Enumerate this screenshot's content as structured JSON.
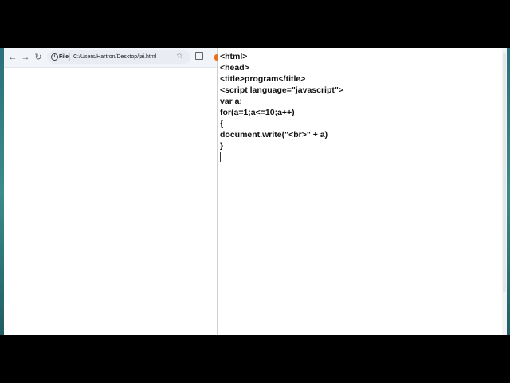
{
  "browser": {
    "back_glyph": "←",
    "forward_glyph": "→",
    "reload_glyph": "↻",
    "info_glyph": "i",
    "file_label": "File",
    "url": "C:/Users/Hartron/Desktop/jai.html",
    "star_glyph": "☆",
    "icons": [
      "back-arrow-icon",
      "forward-arrow-icon",
      "reload-icon",
      "info-icon",
      "star-icon",
      "extensions-icon"
    ]
  },
  "editor": {
    "lines": [
      "<html>",
      "<head>",
      "<title>program</title>",
      "<script language=\"javascript\">",
      "var a;",
      "for(a=1;a<=10;a++)",
      "{",
      "document.write(\"<br>\" + a)",
      "}"
    ]
  },
  "colors": {
    "wallpaper": "#2a6f7a",
    "toolbar": "#f1f4f9",
    "orange_accent": "#e8711a"
  }
}
